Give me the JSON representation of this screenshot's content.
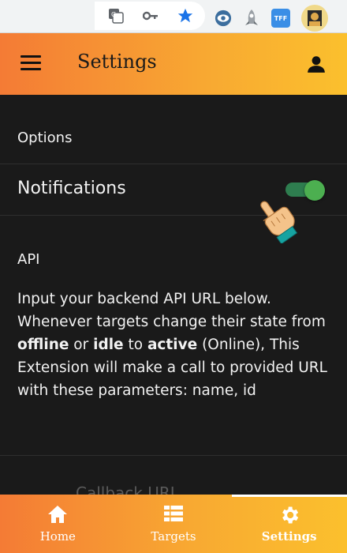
{
  "browser_toolbar": {
    "icons": [
      "translate-icon",
      "key-icon",
      "star-icon",
      "eye-extension-icon",
      "rocket-extension-icon",
      "tff-extension-icon",
      "profile-avatar-icon"
    ],
    "tff_badge": "TFF"
  },
  "header": {
    "title": "Settings",
    "menu_icon": "hamburger-menu-icon",
    "account_icon": "account-icon"
  },
  "options": {
    "section_label": "Options",
    "notifications": {
      "label": "Notifications",
      "enabled": true
    }
  },
  "api": {
    "section_label": "API",
    "desc_1": "Input your backend API URL below. Whenever targets change their state from ",
    "bold_offline": "offline",
    "desc_2": " or ",
    "bold_idle": "idle",
    "desc_3": " to ",
    "bold_active": "active",
    "desc_4": " (Online), This Extension will make a call to provided URL with these parameters: name, id",
    "callback_label": "Callback URL"
  },
  "bottom_nav": {
    "items": [
      {
        "label": "Home",
        "icon": "home-icon",
        "active": false
      },
      {
        "label": "Targets",
        "icon": "list-icon",
        "active": false
      },
      {
        "label": "Settings",
        "icon": "gear-icon",
        "active": true
      }
    ]
  },
  "colors": {
    "accent_start": "#f47b35",
    "accent_end": "#fbc02d",
    "background": "#1a1a1a",
    "toggle_on": "#4caf50"
  }
}
